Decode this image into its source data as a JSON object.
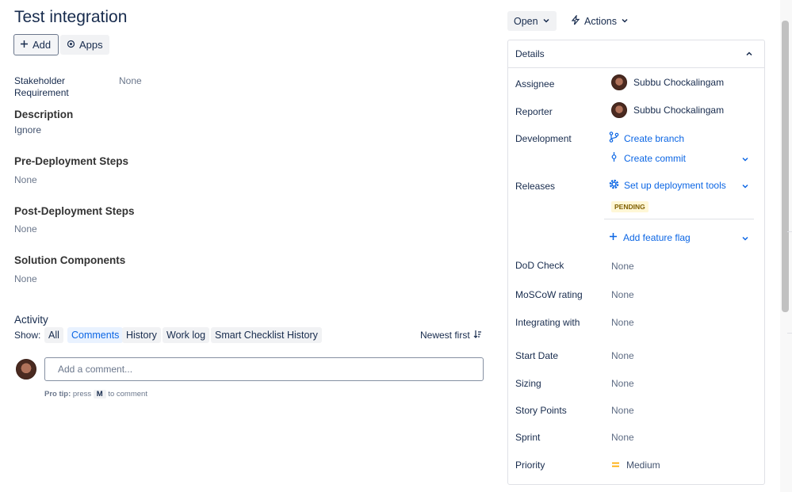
{
  "issue": {
    "title": "Test integration"
  },
  "toolbar": {
    "add_label": "Add",
    "apps_label": "Apps"
  },
  "fields": {
    "stakeholder_label_line1": "Stakeholder",
    "stakeholder_label_line2": "Requirement",
    "stakeholder_value": "None"
  },
  "sections": [
    {
      "heading": "Description",
      "value": "Ignore"
    },
    {
      "heading": "Pre-Deployment Steps",
      "value": "None"
    },
    {
      "heading": "Post-Deployment Steps",
      "value": "None"
    },
    {
      "heading": "Solution Components",
      "value": "None"
    }
  ],
  "activity": {
    "heading": "Activity",
    "show_label": "Show:",
    "filters": [
      "All",
      "Comments",
      "History",
      "Work log",
      "Smart Checklist History"
    ],
    "active_filter": "Comments",
    "sort_label": "Newest first",
    "comment_placeholder": "Add a comment...",
    "protip_bold": "Pro tip:",
    "protip_pre": "press",
    "protip_key": "M",
    "protip_post": "to comment"
  },
  "header_right": {
    "status_label": "Open",
    "actions_label": "Actions"
  },
  "details": {
    "title": "Details",
    "assignee_label": "Assignee",
    "assignee_name": "Subbu Chockalingam",
    "reporter_label": "Reporter",
    "reporter_name": "Subbu Chockalingam",
    "development_label": "Development",
    "create_branch": "Create branch",
    "create_commit": "Create commit",
    "releases_label": "Releases",
    "deployment_tools": "Set up deployment tools",
    "pending_badge": "PENDING",
    "feature_flag": "Add feature flag",
    "dod_label": "DoD Check",
    "dod_value": "None",
    "moscow_label": "MoSCoW rating",
    "moscow_value": "None",
    "integrating_label": "Integrating with",
    "integrating_value": "None",
    "start_label": "Start Date",
    "start_value": "None",
    "sizing_label": "Sizing",
    "sizing_value": "None",
    "story_label": "Story Points",
    "story_value": "None",
    "sprint_label": "Sprint",
    "sprint_value": "None",
    "priority_label": "Priority",
    "priority_value": "Medium"
  },
  "colors": {
    "link": "#0c66e4",
    "priority_medium": "#ffab00",
    "pending_bg": "#fff7d6"
  },
  "icons": [
    "plus-icon",
    "apps-icon",
    "chevron-down-icon",
    "lightning-icon",
    "chevron-up-icon",
    "branch-icon",
    "commit-icon",
    "gear-icon",
    "sort-icon",
    "priority-medium-icon",
    "avatar"
  ]
}
